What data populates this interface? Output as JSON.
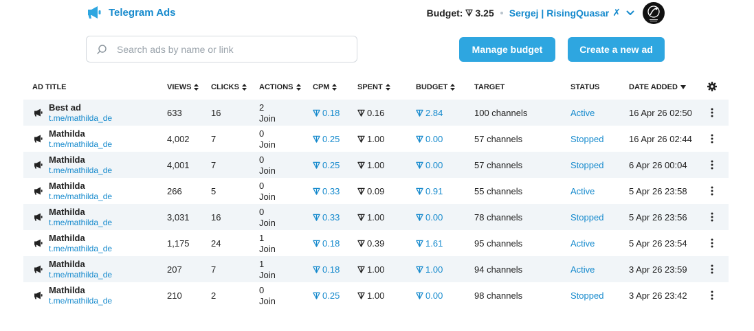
{
  "header": {
    "brand_name": "Telegram Ads",
    "budget_label": "Budget:",
    "budget_value": "3.25",
    "account_name": "Sergej | RisingQuasar",
    "account_suffix": "✗"
  },
  "search": {
    "placeholder": "Search ads by name or link",
    "value": ""
  },
  "actions": {
    "manage_budget": "Manage budget",
    "create_ad": "Create a new ad"
  },
  "table": {
    "columns": {
      "title": "AD TITLE",
      "views": "VIEWS",
      "clicks": "CLICKS",
      "actions": "ACTIONS",
      "cpm": "CPM",
      "spent": "SPENT",
      "budget": "BUDGET",
      "target": "TARGET",
      "status": "STATUS",
      "date": "DATE ADDED"
    },
    "rows": [
      {
        "title": "Best ad",
        "link": "t.me/mathilda_de",
        "views": "633",
        "clicks": "16",
        "actions_count": "2",
        "action_type": "Join",
        "cpm": "0.18",
        "spent": "0.16",
        "budget": "2.84",
        "target": "100 channels",
        "status": "Active",
        "date": "16 Apr 26 02:50"
      },
      {
        "title": "Mathilda",
        "link": "t.me/mathilda_de",
        "views": "4,002",
        "clicks": "7",
        "actions_count": "0",
        "action_type": "Join",
        "cpm": "0.25",
        "spent": "1.00",
        "budget": "0.00",
        "target": "57 channels",
        "status": "Stopped",
        "date": "16 Apr 26 02:44"
      },
      {
        "title": "Mathilda",
        "link": "t.me/mathilda_de",
        "views": "4,001",
        "clicks": "7",
        "actions_count": "0",
        "action_type": "Join",
        "cpm": "0.25",
        "spent": "1.00",
        "budget": "0.00",
        "target": "57 channels",
        "status": "Stopped",
        "date": "6 Apr 26 00:04"
      },
      {
        "title": "Mathilda",
        "link": "t.me/mathilda_de",
        "views": "266",
        "clicks": "5",
        "actions_count": "0",
        "action_type": "Join",
        "cpm": "0.33",
        "spent": "0.09",
        "budget": "0.91",
        "target": "55 channels",
        "status": "Active",
        "date": "5 Apr 26 23:58"
      },
      {
        "title": "Mathilda",
        "link": "t.me/mathilda_de",
        "views": "3,031",
        "clicks": "16",
        "actions_count": "0",
        "action_type": "Join",
        "cpm": "0.33",
        "spent": "1.00",
        "budget": "0.00",
        "target": "78 channels",
        "status": "Stopped",
        "date": "5 Apr 26 23:56"
      },
      {
        "title": "Mathilda",
        "link": "t.me/mathilda_de",
        "views": "1,175",
        "clicks": "24",
        "actions_count": "1",
        "action_type": "Join",
        "cpm": "0.18",
        "spent": "0.39",
        "budget": "1.61",
        "target": "95 channels",
        "status": "Active",
        "date": "5 Apr 26 23:54"
      },
      {
        "title": "Mathilda",
        "link": "t.me/mathilda_de",
        "views": "207",
        "clicks": "7",
        "actions_count": "1",
        "action_type": "Join",
        "cpm": "0.18",
        "spent": "1.00",
        "budget": "1.00",
        "target": "94 channels",
        "status": "Active",
        "date": "3 Apr 26 23:59"
      },
      {
        "title": "Mathilda",
        "link": "t.me/mathilda_de",
        "views": "210",
        "clicks": "2",
        "actions_count": "0",
        "action_type": "Join",
        "cpm": "0.25",
        "spent": "1.00",
        "budget": "0.00",
        "target": "98 channels",
        "status": "Stopped",
        "date": "3 Apr 26 23:42"
      }
    ]
  },
  "colors": {
    "accent": "#2ea6e0",
    "link": "#168acd",
    "row_alt": "#f1f5f8"
  }
}
